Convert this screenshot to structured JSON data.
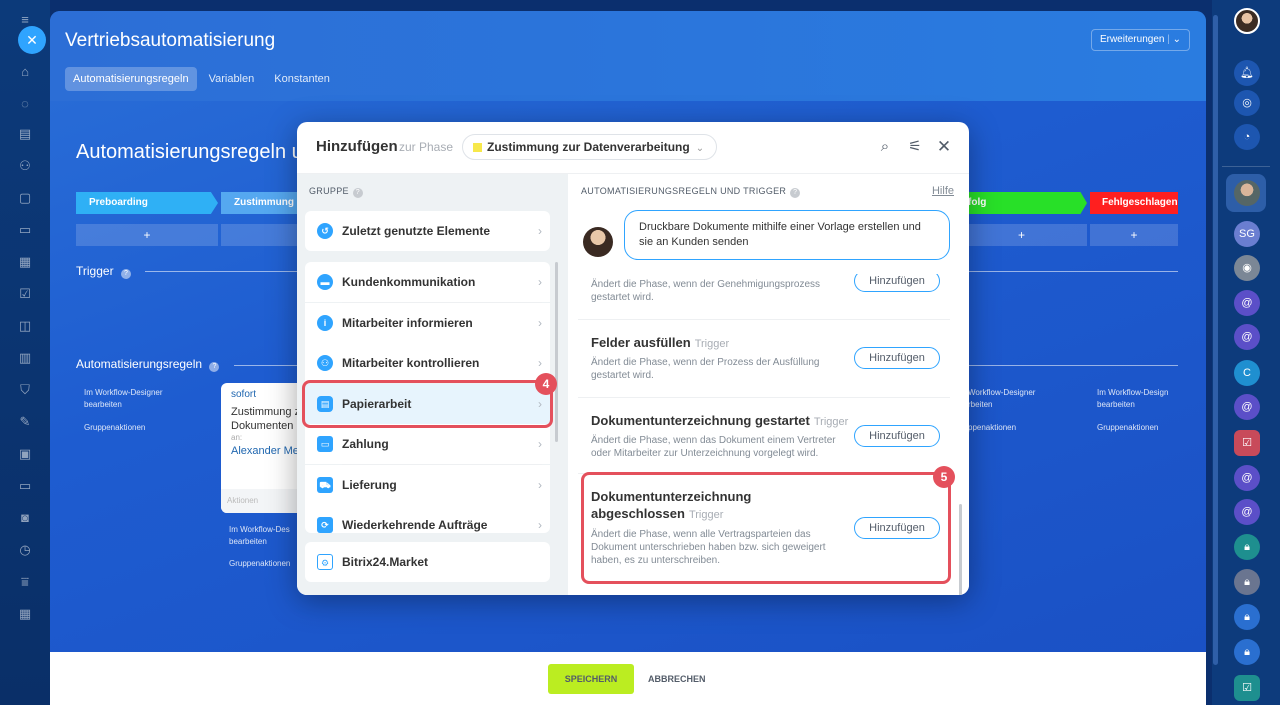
{
  "window": {
    "title": "Vertriebsautomatisierung",
    "extensions_button": "Erweiterungen",
    "tabs": [
      {
        "label": "Automatisierungsregeln",
        "active": true
      },
      {
        "label": "Variablen",
        "active": false
      },
      {
        "label": "Konstanten",
        "active": false
      }
    ]
  },
  "background": {
    "heading": "Automatisierungsregeln ur",
    "stages": [
      {
        "label": "Preboarding",
        "color": "#2fb0f5"
      },
      {
        "label": "Zustimmung",
        "color": "#55a8f0"
      },
      {
        "label": "folg",
        "color": "#28e028"
      },
      {
        "label": "Fehlgeschlagen",
        "color": "#ff1f1f"
      }
    ],
    "add_label": "+",
    "trigger_section": "Trigger",
    "rules_section": "Automatisierungsregeln",
    "workflow_designer": "Im Workflow-Designer bearbeiten",
    "workflow_designer_short": "Im Workflow-Des bearbeiten",
    "workflow_designer_right1": "Workflow-Designer rbeiten",
    "workflow_designer_right2": "Im Workflow-Design bearbeiten",
    "group_actions": "Gruppenaktionen",
    "group_actions_short": "Gruppenaktionen",
    "group_actions_right": "ppenaktionen",
    "robot_card": {
      "link": "sofort",
      "text": "Zustimmung z Dokumenten",
      "to": "an:",
      "user": "Alexander Me",
      "actions": "Aktionen"
    }
  },
  "footer": {
    "save": "SPEICHERN",
    "cancel": "ABBRECHEN"
  },
  "dialog": {
    "title": "Hinzufügen",
    "phase_label": "zur Phase",
    "phase_value": "Zustimmung zur Datenverarbeitung",
    "phase_color": "#f7e84b",
    "group_heading": "GRUPPE",
    "rules_heading": "AUTOMATISIERUNGSREGELN UND TRIGGER",
    "help_link": "Hilfe",
    "groups": [
      {
        "label": "Zuletzt genutzte Elemente",
        "icon": "history-icon",
        "color": "#2fa4ff"
      },
      {
        "label": "Kundenkommunikation",
        "icon": "chat-icon",
        "color": "#2fa4ff"
      },
      {
        "label": "Mitarbeiter informieren",
        "icon": "info-icon",
        "color": "#2fa4ff"
      },
      {
        "label": "Mitarbeiter kontrollieren",
        "icon": "people-icon",
        "color": "#2fa4ff"
      },
      {
        "label": "Papierarbeit",
        "icon": "document-icon",
        "color": "#2fa4ff"
      },
      {
        "label": "Zahlung",
        "icon": "wallet-icon",
        "color": "#2fa4ff"
      },
      {
        "label": "Lieferung",
        "icon": "truck-icon",
        "color": "#2fa4ff"
      },
      {
        "label": "Wiederkehrende Aufträge",
        "icon": "repeat-icon",
        "color": "#2fa4ff"
      },
      {
        "label": "Bitrix24.Market",
        "icon": "market-icon",
        "color": "#2fa4ff"
      }
    ],
    "hint": "Druckbare Dokumente mithilfe einer Vorlage erstellen und sie an Kunden senden",
    "triggers": [
      {
        "title": "",
        "kind": "",
        "desc": "Ändert die Phase, wenn der Genehmigungsprozess gestartet wird.",
        "button": "Hinzufügen"
      },
      {
        "title": "Felder ausfüllen",
        "kind": "Trigger",
        "desc": "Ändert die Phase, wenn der Prozess der Ausfüllung gestartet wird.",
        "button": "Hinzufügen"
      },
      {
        "title": "Dokumentunterzeichnung gestartet",
        "kind": "Trigger",
        "desc": "Ändert die Phase, wenn das Dokument einem Vertreter oder Mitarbeiter zur Unterzeichnung vorgelegt wird.",
        "button": "Hinzufügen"
      },
      {
        "title": "Dokumentunterzeichnung abgeschlossen",
        "kind": "Trigger",
        "desc": "Ändert die Phase, wenn alle Vertragsparteien das Dokument unterschrieben haben bzw. sich geweigert haben, es zu unterschreiben.",
        "button": "Hinzufügen"
      }
    ],
    "badges": {
      "group": "4",
      "trigger": "5"
    }
  },
  "right_rail": {
    "items": [
      "bell-icon",
      "target-icon",
      "chat-bubble-icon",
      "avatar",
      "SG",
      "avatar",
      "at-icon",
      "at-icon",
      "C",
      "at-icon",
      "check-icon",
      "at-icon",
      "at-icon",
      "lock-icon",
      "lock-icon",
      "lock-icon",
      "lock-icon",
      "check-icon"
    ]
  }
}
